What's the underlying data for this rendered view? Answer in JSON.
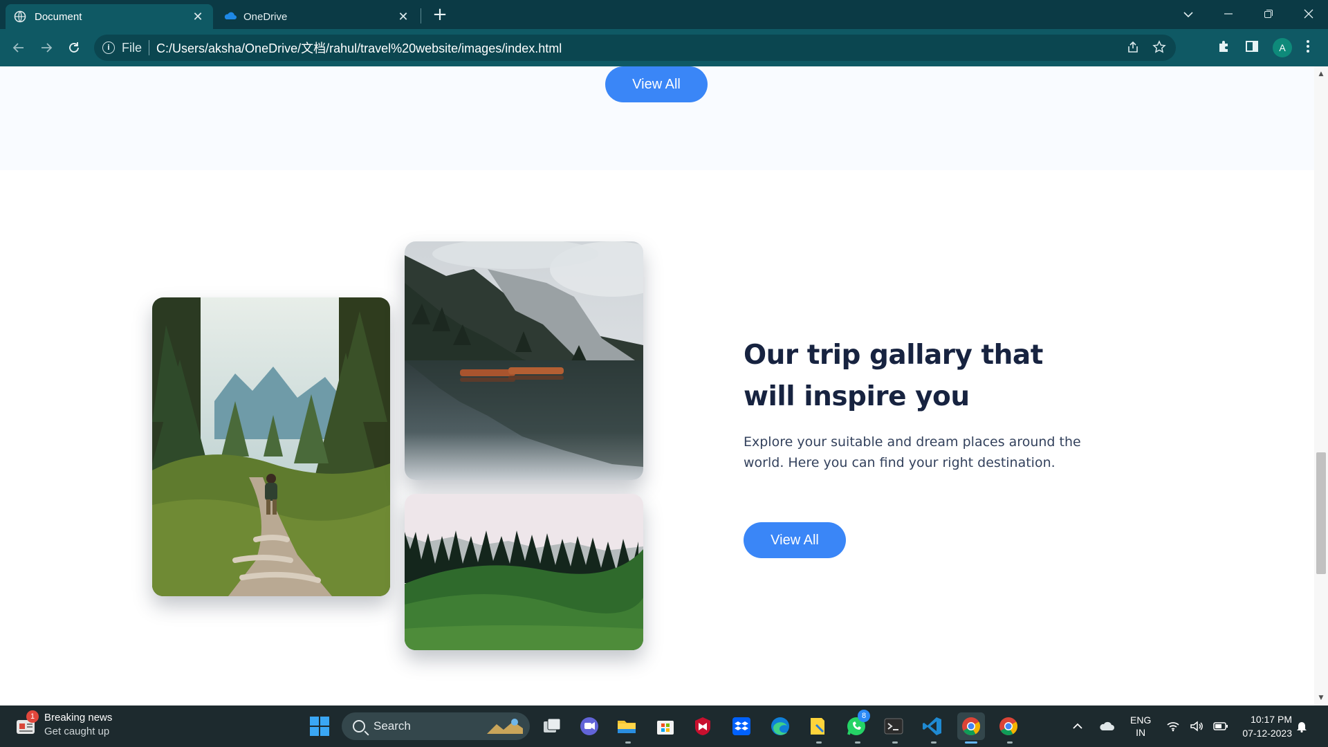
{
  "browser": {
    "tabs": [
      {
        "title": "Document",
        "active": true,
        "icon": "globe-icon"
      },
      {
        "title": "OneDrive",
        "active": false,
        "icon": "onedrive-cloud-icon"
      }
    ],
    "new_tab": "+",
    "close_glyph": "✕",
    "omnibox": {
      "scheme_label": "File",
      "url": "C:/Users/aksha/OneDrive/文档/rahul/travel%20website/images/index.html"
    },
    "profile_initial": "A",
    "colors": {
      "tabstrip": "#0b3a45",
      "toolbar": "#0f5964"
    }
  },
  "page": {
    "top_button_label": "View All",
    "gallery": {
      "title": "Our trip gallary that will inspire you",
      "description": "Explore your suitable and dream places around the world. Here you can find your right destination.",
      "button_label": "View All",
      "images": [
        "hiker-forest-trail",
        "mountain-lake-boats",
        "green-meadow-forest"
      ]
    },
    "colors": {
      "accent": "#3a86f7",
      "heading": "#172340",
      "body_text": "#33415c"
    }
  },
  "taskbar": {
    "news": {
      "title": "Breaking news",
      "subtitle": "Get caught up",
      "badge": "1"
    },
    "search_placeholder": "Search",
    "whatsapp_badge": "8",
    "language": {
      "line1": "ENG",
      "line2": "IN"
    },
    "time": "10:17 PM",
    "date": "07-12-2023"
  }
}
